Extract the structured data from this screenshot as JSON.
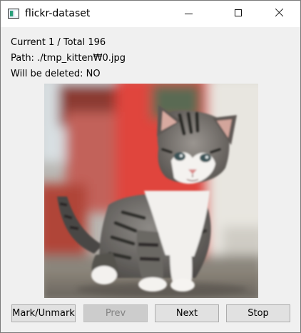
{
  "window": {
    "title": "flickr-dataset"
  },
  "info": {
    "current": "Current 1 / Total 196",
    "path": "Path: ./tmp_kitten₩0.jpg",
    "will_delete": "Will be deleted: NO"
  },
  "buttons": {
    "mark": "Mark/Unmark",
    "prev": "Prev",
    "next": "Next",
    "stop": "Stop"
  },
  "icons": {
    "app": "app-window-icon",
    "minimize": "minimize-icon",
    "maximize": "maximize-icon",
    "close": "close-icon"
  },
  "colors": {
    "window_bg": "#f0f0f0",
    "titlebar_bg": "#ffffff",
    "button_bg": "#e1e1e1",
    "button_disabled_bg": "#cccccc",
    "button_disabled_text": "#838383"
  }
}
